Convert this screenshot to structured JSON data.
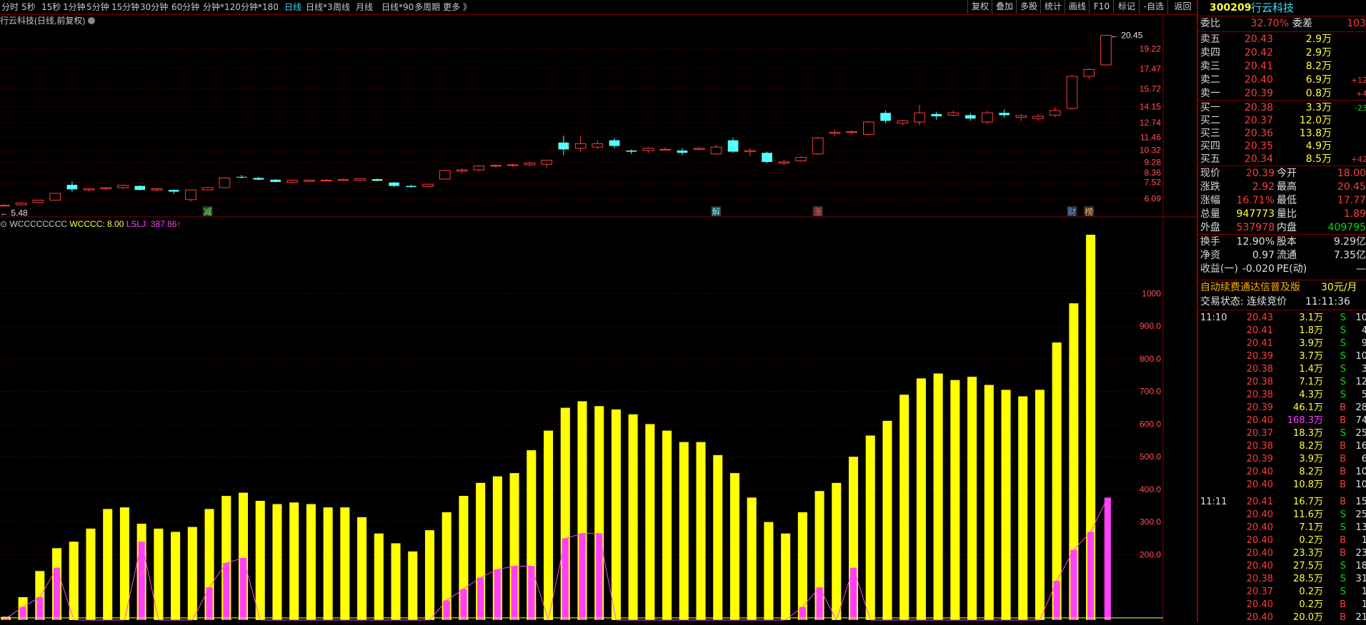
{
  "toolbar": {
    "tabs": [
      "分时",
      "5秒",
      "15秒",
      "1分钟",
      "5分钟",
      "15分钟",
      "30分钟",
      "60分钟",
      "分钟*120",
      "分钟*180",
      "日线",
      "日线*3",
      "周线",
      "月线",
      "日线*90",
      "多周期",
      "更多 》"
    ],
    "active_tab": "日线",
    "buttons": [
      "复权",
      "叠加",
      "多股",
      "统计",
      "画线",
      "F10",
      "标记",
      "-自选",
      "返回"
    ]
  },
  "chart": {
    "title": "行云科技(日线,前复权)",
    "price_max_label": "20.45",
    "price_min_label": "5.48",
    "y_ticks": [
      "19.22",
      "17.47",
      "15.72",
      "14.15",
      "12.74",
      "11.46",
      "10.32",
      "9.28",
      "8.36",
      "7.52",
      "6.09"
    ],
    "event_marks": [
      {
        "text": "减",
        "color": "#60ff60",
        "idx": 12
      },
      {
        "text": "解",
        "color": "#60ffff",
        "idx": 42
      },
      {
        "text": "涨",
        "color": "#ff6060",
        "idx": 48
      },
      {
        "text": "财",
        "color": "#60a0ff",
        "idx": 63
      },
      {
        "text": "榜",
        "color": "#ffb060",
        "idx": 64
      }
    ],
    "candles": [
      [
        5.5,
        5.6,
        5.45,
        5.5
      ],
      [
        5.55,
        5.75,
        5.5,
        5.7
      ],
      [
        5.75,
        6.0,
        5.7,
        5.95
      ],
      [
        5.95,
        6.6,
        5.9,
        6.55
      ],
      [
        7.3,
        7.6,
        6.7,
        6.9
      ],
      [
        6.85,
        7.0,
        6.7,
        6.95
      ],
      [
        6.95,
        7.1,
        6.8,
        7.05
      ],
      [
        7.05,
        7.3,
        6.9,
        7.25
      ],
      [
        7.2,
        7.25,
        6.8,
        6.85
      ],
      [
        6.85,
        7.0,
        6.7,
        6.95
      ],
      [
        6.85,
        6.9,
        6.5,
        6.7
      ],
      [
        6.0,
        6.9,
        5.8,
        6.85
      ],
      [
        6.85,
        7.1,
        6.8,
        7.05
      ],
      [
        7.05,
        7.95,
        7.0,
        7.9
      ],
      [
        8.0,
        8.15,
        7.85,
        7.95
      ],
      [
        7.9,
        8.0,
        7.7,
        7.75
      ],
      [
        7.75,
        7.8,
        7.5,
        7.55
      ],
      [
        7.5,
        7.75,
        7.4,
        7.7
      ],
      [
        7.6,
        7.75,
        7.55,
        7.7
      ],
      [
        7.7,
        7.8,
        7.6,
        7.7
      ],
      [
        7.7,
        7.85,
        7.65,
        7.75
      ],
      [
        7.7,
        7.9,
        7.65,
        7.85
      ],
      [
        7.8,
        7.85,
        7.6,
        7.65
      ],
      [
        7.5,
        7.55,
        7.1,
        7.2
      ],
      [
        7.2,
        7.3,
        7.05,
        7.1
      ],
      [
        7.15,
        7.4,
        7.1,
        7.35
      ],
      [
        7.8,
        8.6,
        7.75,
        8.55
      ],
      [
        8.5,
        8.75,
        8.3,
        8.6
      ],
      [
        8.6,
        9.0,
        8.5,
        8.95
      ],
      [
        8.95,
        9.1,
        8.8,
        9.0
      ],
      [
        9.0,
        9.15,
        8.85,
        9.05
      ],
      [
        9.05,
        9.3,
        8.9,
        9.2
      ],
      [
        9.1,
        9.5,
        8.8,
        9.45
      ],
      [
        11.0,
        11.6,
        9.9,
        10.4
      ],
      [
        10.5,
        11.6,
        10.2,
        10.9
      ],
      [
        10.6,
        11.2,
        10.4,
        10.9
      ],
      [
        11.2,
        11.4,
        10.5,
        10.7
      ],
      [
        10.3,
        10.4,
        10.0,
        10.2
      ],
      [
        10.3,
        10.6,
        10.1,
        10.5
      ],
      [
        10.4,
        10.6,
        10.3,
        10.4
      ],
      [
        10.3,
        10.5,
        9.9,
        10.1
      ],
      [
        10.4,
        10.6,
        10.3,
        10.5
      ],
      [
        10.0,
        10.8,
        9.9,
        10.6
      ],
      [
        11.2,
        11.4,
        10.1,
        10.2
      ],
      [
        10.2,
        10.5,
        9.8,
        10.3
      ],
      [
        10.1,
        10.2,
        9.2,
        9.3
      ],
      [
        9.2,
        9.5,
        9.0,
        9.3
      ],
      [
        9.4,
        9.8,
        9.3,
        9.7
      ],
      [
        10.0,
        11.5,
        9.9,
        11.4
      ],
      [
        11.8,
        12.1,
        11.6,
        11.9
      ],
      [
        11.9,
        12.1,
        11.7,
        11.95
      ],
      [
        11.7,
        12.9,
        11.6,
        12.8
      ],
      [
        13.6,
        13.8,
        12.7,
        12.9
      ],
      [
        12.7,
        13.0,
        12.5,
        12.9
      ],
      [
        12.8,
        14.3,
        12.5,
        13.6
      ],
      [
        13.5,
        13.7,
        13.0,
        13.3
      ],
      [
        13.4,
        13.8,
        13.3,
        13.6
      ],
      [
        13.4,
        13.6,
        12.9,
        13.1
      ],
      [
        12.8,
        13.8,
        12.6,
        13.6
      ],
      [
        13.6,
        13.9,
        13.2,
        13.4
      ],
      [
        13.2,
        13.5,
        12.9,
        13.35
      ],
      [
        13.1,
        13.5,
        12.9,
        13.3
      ],
      [
        13.4,
        14.1,
        13.2,
        13.8
      ],
      [
        14.0,
        16.9,
        13.9,
        16.8
      ],
      [
        16.8,
        17.5,
        16.6,
        17.4
      ],
      [
        17.8,
        20.45,
        17.7,
        20.39
      ]
    ],
    "indicator_label_name": "WCCCCCCCC",
    "indicator_label_wccc": "WCCCC: 8.00",
    "indicator_label_lslj": "LSLJ: 387.86↑",
    "lower_ticks": [
      "1000",
      "900.0",
      "800.0",
      "700.0",
      "600.0",
      "500.0",
      "400.0",
      "300.0",
      "200.0"
    ]
  },
  "chart_data": {
    "type": "bar",
    "title": "",
    "series": [
      {
        "values": [
          10,
          70,
          150,
          220,
          240,
          280,
          340,
          345,
          295,
          280,
          270,
          285,
          340,
          380,
          390,
          365,
          355,
          360,
          355,
          345,
          345,
          315,
          265,
          235,
          210,
          275,
          330,
          380,
          420,
          440,
          450,
          520,
          580,
          650,
          670,
          655,
          645,
          630,
          600,
          580,
          545,
          545,
          505,
          450,
          375,
          300,
          265,
          330,
          395,
          420,
          500,
          565,
          610,
          690,
          740,
          755,
          735,
          745,
          720,
          705,
          685,
          705,
          850,
          970,
          1180
        ]
      },
      {
        "values": [
          5,
          40,
          70,
          160,
          0,
          0,
          0,
          0,
          240,
          0,
          0,
          0,
          100,
          175,
          190,
          0,
          0,
          0,
          0,
          0,
          0,
          0,
          0,
          0,
          0,
          0,
          60,
          95,
          130,
          155,
          165,
          165,
          0,
          250,
          265,
          265,
          0,
          0,
          0,
          0,
          0,
          0,
          0,
          0,
          0,
          0,
          0,
          40,
          100,
          0,
          160,
          0,
          0,
          0,
          0,
          0,
          0,
          0,
          0,
          0,
          0,
          0,
          120,
          215,
          270,
          375
        ]
      }
    ]
  },
  "panel": {
    "code": "300209",
    "name": "行云科技",
    "weibi_label": "委比",
    "weibi": "32.70%",
    "weicha_label": "委差",
    "weicha": "103",
    "asks": [
      {
        "label": "卖五",
        "price": "20.43",
        "vol": "2.9万",
        "chg": ""
      },
      {
        "label": "卖四",
        "price": "20.42",
        "vol": "2.9万",
        "chg": ""
      },
      {
        "label": "卖三",
        "price": "20.41",
        "vol": "8.2万",
        "chg": ""
      },
      {
        "label": "卖二",
        "price": "20.40",
        "vol": "6.9万",
        "chg": "+12"
      },
      {
        "label": "卖一",
        "price": "20.39",
        "vol": "0.8万",
        "chg": "+4"
      }
    ],
    "bids": [
      {
        "label": "买一",
        "price": "20.38",
        "vol": "3.3万",
        "chg": "-23"
      },
      {
        "label": "买二",
        "price": "20.37",
        "vol": "12.0万",
        "chg": ""
      },
      {
        "label": "买三",
        "price": "20.36",
        "vol": "13.8万",
        "chg": ""
      },
      {
        "label": "买四",
        "price": "20.35",
        "vol": "4.9万",
        "chg": ""
      },
      {
        "label": "买五",
        "price": "20.34",
        "vol": "8.5万",
        "chg": "+42"
      }
    ],
    "stats": [
      {
        "l1": "现价",
        "v1": "20.39",
        "c1": "red",
        "l2": "今开",
        "v2": "18.00",
        "c2": "red"
      },
      {
        "l1": "涨跌",
        "v1": "2.92",
        "c1": "red",
        "l2": "最高",
        "v2": "20.45",
        "c2": "red"
      },
      {
        "l1": "涨幅",
        "v1": "16.71%",
        "c1": "red",
        "l2": "最低",
        "v2": "17.77",
        "c2": "red"
      },
      {
        "l1": "总量",
        "v1": "947773",
        "c1": "yel",
        "l2": "量比",
        "v2": "1.89",
        "c2": "red"
      },
      {
        "l1": "外盘",
        "v1": "537978",
        "c1": "red",
        "l2": "内盘",
        "v2": "409795",
        "c2": "grn"
      }
    ],
    "stats2": [
      {
        "l1": "换手",
        "v1": "12.90%",
        "c1": "wht",
        "l2": "股本",
        "v2": "9.29亿",
        "c2": "wht"
      },
      {
        "l1": "净资",
        "v1": "0.97",
        "c1": "wht",
        "l2": "流通",
        "v2": "7.35亿",
        "c2": "wht"
      },
      {
        "l1": "收益(一)",
        "v1": "-0.020",
        "c1": "wht",
        "l2": "PE(动)",
        "v2": "—",
        "c2": "wht"
      }
    ],
    "promo": "自动续费通达信普及版",
    "promo_price": "30元/月",
    "status_label": "交易状态: 连续竞价",
    "status_time": "11:11:36",
    "ticks": [
      {
        "time": "11:10",
        "price": "20.43",
        "vol": "3.1万",
        "bs": "S",
        "n": "10"
      },
      {
        "time": "",
        "price": "20.41",
        "vol": "1.8万",
        "bs": "S",
        "n": "4"
      },
      {
        "time": "",
        "price": "20.41",
        "vol": "3.9万",
        "bs": "S",
        "n": "9"
      },
      {
        "time": "",
        "price": "20.39",
        "vol": "3.7万",
        "bs": "S",
        "n": "10"
      },
      {
        "time": "",
        "price": "20.38",
        "vol": "1.4万",
        "bs": "S",
        "n": "3"
      },
      {
        "time": "",
        "price": "20.38",
        "vol": "7.1万",
        "bs": "S",
        "n": "12"
      },
      {
        "time": "",
        "price": "20.38",
        "vol": "4.3万",
        "bs": "S",
        "n": "5"
      },
      {
        "time": "",
        "price": "20.39",
        "vol": "46.1万",
        "bs": "B",
        "n": "28"
      },
      {
        "time": "",
        "price": "20.40",
        "vol": "168.3万",
        "bs": "B",
        "n": "74"
      },
      {
        "time": "",
        "price": "20.37",
        "vol": "18.3万",
        "bs": "S",
        "n": "25"
      },
      {
        "time": "",
        "price": "20.38",
        "vol": "8.2万",
        "bs": "B",
        "n": "16"
      },
      {
        "time": "",
        "price": "20.39",
        "vol": "3.9万",
        "bs": "B",
        "n": "6"
      },
      {
        "time": "",
        "price": "20.40",
        "vol": "8.2万",
        "bs": "B",
        "n": "10"
      },
      {
        "time": "",
        "price": "20.40",
        "vol": "10.8万",
        "bs": "B",
        "n": "10"
      },
      {
        "time": "11:11",
        "price": "20.41",
        "vol": "16.7万",
        "bs": "B",
        "n": "15"
      },
      {
        "time": "",
        "price": "20.40",
        "vol": "11.6万",
        "bs": "S",
        "n": "25"
      },
      {
        "time": "",
        "price": "20.40",
        "vol": "7.1万",
        "bs": "S",
        "n": "13"
      },
      {
        "time": "",
        "price": "20.40",
        "vol": "0.2万",
        "bs": "B",
        "n": "1"
      },
      {
        "time": "",
        "price": "20.40",
        "vol": "23.3万",
        "bs": "B",
        "n": "23"
      },
      {
        "time": "",
        "price": "20.40",
        "vol": "27.5万",
        "bs": "S",
        "n": "18"
      },
      {
        "time": "",
        "price": "20.38",
        "vol": "28.5万",
        "bs": "S",
        "n": "31"
      },
      {
        "time": "",
        "price": "20.37",
        "vol": "0.2万",
        "bs": "S",
        "n": "1"
      },
      {
        "time": "",
        "price": "20.40",
        "vol": "0.2万",
        "bs": "B",
        "n": "1"
      },
      {
        "time": "",
        "price": "20.40",
        "vol": "20.0万",
        "bs": "B",
        "n": "21"
      }
    ]
  },
  "colors": {
    "up": "#ff3c3c",
    "down": "#54ffff",
    "bar": "#ffff00",
    "line": "#ff40ff",
    "grid": "#5a0000"
  }
}
